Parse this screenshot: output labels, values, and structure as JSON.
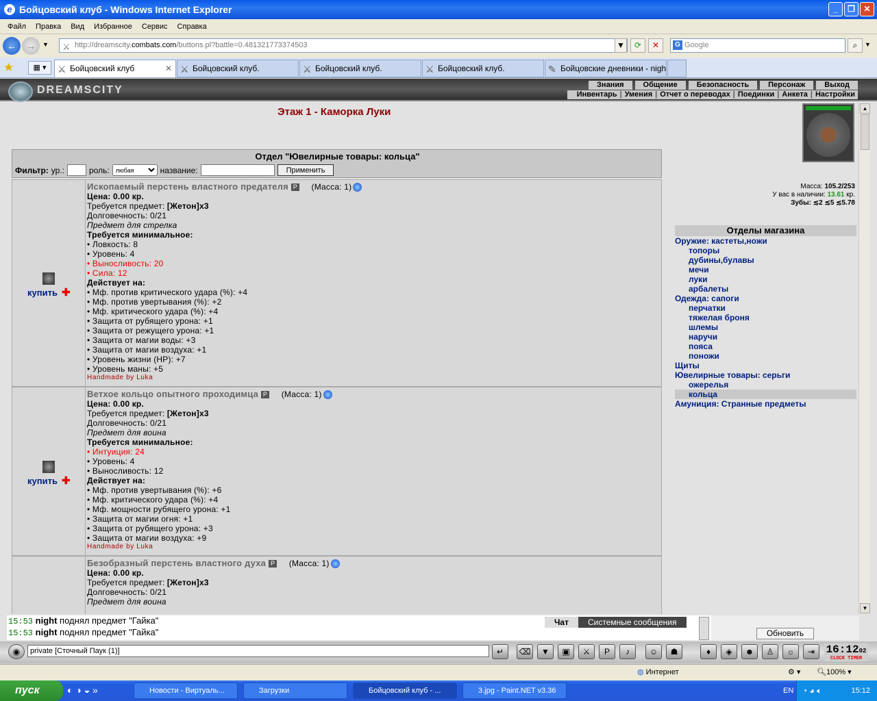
{
  "window": {
    "title": "Бойцовский клуб - Windows Internet Explorer"
  },
  "menu": [
    "Файл",
    "Правка",
    "Вид",
    "Избранное",
    "Сервис",
    "Справка"
  ],
  "address": {
    "prefix": "http://dreamscity.",
    "domain": "combats.com",
    "suffix": "/buttons.pl?battle=0.481321773374503"
  },
  "search": {
    "placeholder": "Google"
  },
  "tabs": [
    "Бойцовский клуб",
    "Бойцовский клуб.",
    "Бойцовский клуб.",
    "Бойцовский клуб.",
    "Бойцовские дневники - night"
  ],
  "game": {
    "logo": "DREAMSCITY",
    "nav_top": [
      "Знания",
      "Общение",
      "Безопасность",
      "Персонаж",
      "Выход"
    ],
    "nav_bottom": [
      "Инвентарь",
      "Умения",
      "Отчет о переводах",
      "Поединки",
      "Анкета",
      "Настройки"
    ],
    "page_title": "Этаж 1 - Каморка Луки",
    "section_title": "Отдел \"Ювелирные товары: кольца\"",
    "filter": {
      "label": "Фильтр:",
      "level": "ур.:",
      "role": "роль:",
      "role_value": "любая",
      "name": "название:",
      "apply": "Применить"
    },
    "buy_label": "купить",
    "items": [
      {
        "name": "Ископаемый перстень властного предателя",
        "mass": "(Масса: 1)",
        "price": "Цена: 0.00 кр.",
        "req_item_label": "Требуется предмет:",
        "req_item": "[Жетон]x3",
        "durability": "Долговечность: 0/21",
        "purpose": "Предмет для стрелка",
        "min_req": "Требуется минимальное:",
        "reqs": [
          {
            "text": "• Ловкость: 8",
            "red": false
          },
          {
            "text": "• Уровень: 4",
            "red": false
          },
          {
            "text": "• Выносливость: 20",
            "red": true
          },
          {
            "text": "• Сила: 12",
            "red": true
          }
        ],
        "effects_label": "Действует на:",
        "effects": [
          "• Мф. против критического удара (%): +4",
          "• Мф. против увертывания (%): +2",
          "• Мф. критического удара (%): +4",
          "• Защита от рубящего урона: +1",
          "• Защита от режущего урона: +1",
          "• Защита от магии воды: +3",
          "• Защита от магии воздуха: +1",
          "• Уровень жизни (HP): +7",
          "• Уровень маны: +5"
        ],
        "maker": "Handmade by Luka"
      },
      {
        "name": "Ветхое кольцо опытного проходимца",
        "mass": "(Масса: 1)",
        "price": "Цена: 0.00 кр.",
        "req_item_label": "Требуется предмет:",
        "req_item": "[Жетон]x3",
        "durability": "Долговечность: 0/21",
        "purpose": "Предмет для воина",
        "min_req": "Требуется минимальное:",
        "reqs": [
          {
            "text": "• Интуиция: 24",
            "red": true
          },
          {
            "text": "• Уровень: 4",
            "red": false
          },
          {
            "text": "• Выносливость: 12",
            "red": false
          }
        ],
        "effects_label": "Действует на:",
        "effects": [
          "• Мф. против увертывания (%): +6",
          "• Мф. критического удара (%): +4",
          "• Мф. мощности рубящего урона: +1",
          "• Защита от магии огня: +1",
          "• Защита от рубящего урона: +3",
          "• Защита от магии воздуха: +9"
        ],
        "maker": "Handmade by Luka"
      },
      {
        "name": "Безобразный перстень властного духа",
        "mass": "(Масса: 1)",
        "price": "Цена: 0.00 кр.",
        "req_item_label": "Требуется предмет:",
        "req_item": "[Жетон]x3",
        "durability": "Долговечность: 0/21",
        "purpose": "Предмет для воина",
        "min_req": "",
        "reqs": [],
        "effects_label": "",
        "effects": [],
        "maker": ""
      }
    ],
    "stats": {
      "mass_label": "Масса:",
      "mass": "105.2/253",
      "money_label": "У вас в наличии:",
      "money": "13.61",
      "money_unit": "кр.",
      "teeth_label": "Зубы:",
      "teeth": "≲2 ≲5 ≲5.78"
    },
    "depts": {
      "title": "Отделы магазина",
      "items": [
        {
          "text": "Оружие: кастеты,ножи",
          "sub": false
        },
        {
          "text": "топоры",
          "sub": true
        },
        {
          "text": "дубины,булавы",
          "sub": true
        },
        {
          "text": "мечи",
          "sub": true
        },
        {
          "text": "луки",
          "sub": true
        },
        {
          "text": "арбалеты",
          "sub": true
        },
        {
          "text": "Одежда: сапоги",
          "sub": false
        },
        {
          "text": "перчатки",
          "sub": true
        },
        {
          "text": "тяжелая броня",
          "sub": true
        },
        {
          "text": "шлемы",
          "sub": true
        },
        {
          "text": "наручи",
          "sub": true
        },
        {
          "text": "пояса",
          "sub": true
        },
        {
          "text": "поножи",
          "sub": true
        },
        {
          "text": "Щиты",
          "sub": false
        },
        {
          "text": "Ювелирные товары: серьги",
          "sub": false
        },
        {
          "text": "ожерелья",
          "sub": true
        },
        {
          "text": "кольца",
          "sub": true,
          "selected": true
        },
        {
          "text": "Амуниция: Странные предметы",
          "sub": false
        }
      ]
    },
    "chat": {
      "lines": [
        {
          "time": "15:53",
          "nick": "night",
          "text": "поднял предмет \"Гайка\""
        },
        {
          "time": "15:53",
          "nick": "night",
          "text": "поднял предмет \"Гайка\""
        }
      ],
      "tab_chat": "Чат",
      "tab_system": "Системные сообщения",
      "refresh": "Обновить",
      "input": "private [Сточный Паук (1)]"
    },
    "clock": {
      "time": "16:12",
      "sec": "02",
      "label": "CLOCK TIMER"
    }
  },
  "status": {
    "zone": "Интернет",
    "zoom": "100%"
  },
  "taskbar": {
    "start": "пуск",
    "buttons": [
      "Новости - Виртуаль...",
      "Загрузки",
      "Бойцовский клуб - ...",
      "3.jpg - Paint.NET v3.36"
    ],
    "lang": "EN",
    "time": "15:12"
  }
}
